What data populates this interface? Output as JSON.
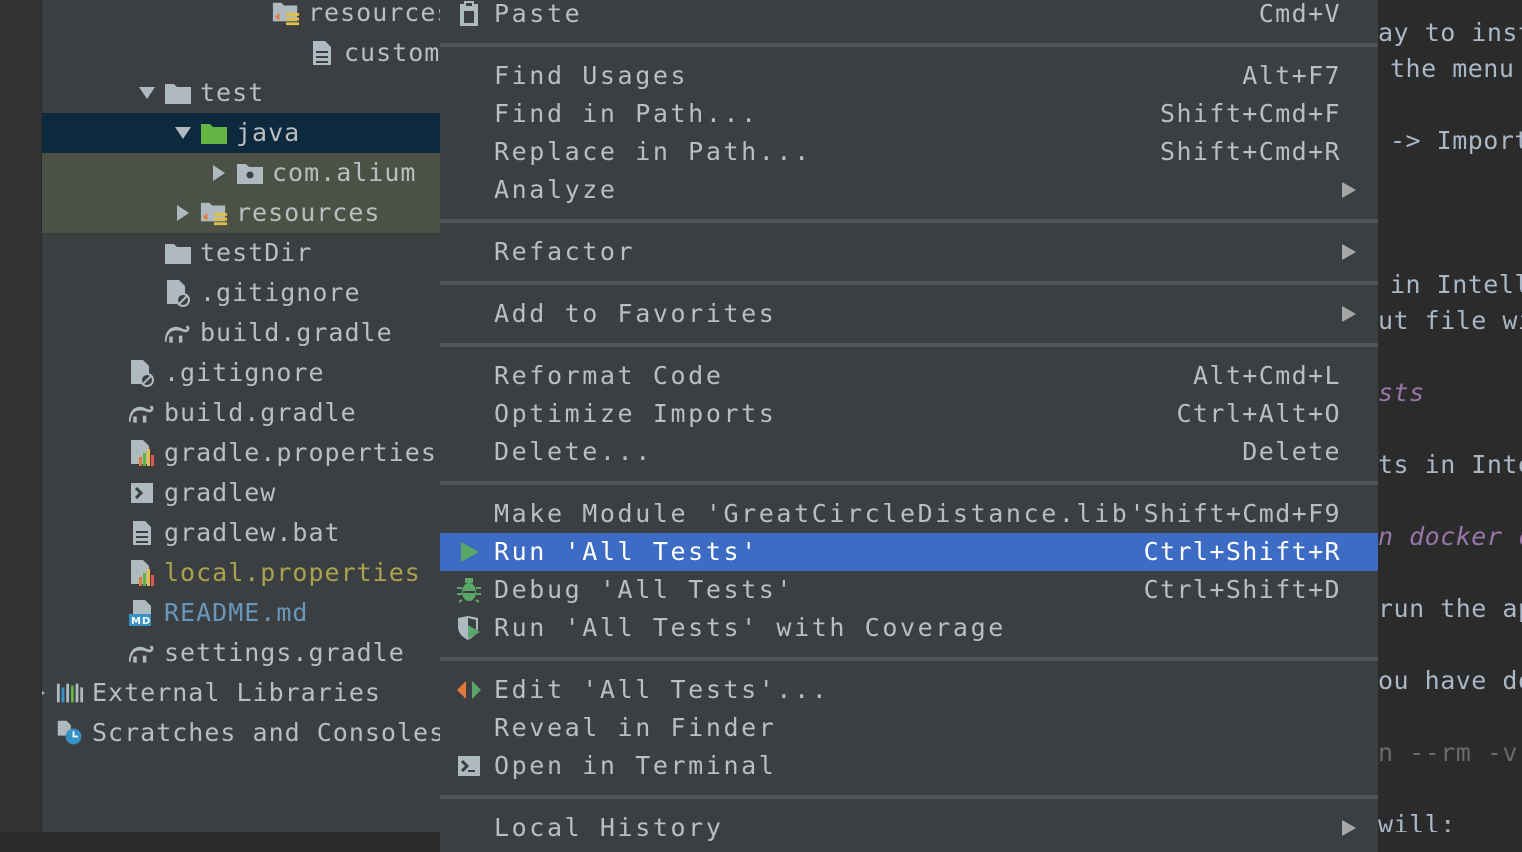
{
  "tree": {
    "rows": [
      {
        "label": "resources",
        "indent": 7,
        "arrow": "",
        "icon": "resources-folder-icon",
        "state": "normal",
        "color": "normal"
      },
      {
        "label": "customers",
        "indent": 8,
        "arrow": "",
        "icon": "file-icon",
        "state": "normal",
        "color": "normal"
      },
      {
        "label": "test",
        "indent": 4,
        "arrow": "down",
        "icon": "folder-icon",
        "state": "normal",
        "color": "normal"
      },
      {
        "label": "java",
        "indent": 5,
        "arrow": "down",
        "icon": "test-source-folder-icon",
        "state": "selected",
        "color": "normal"
      },
      {
        "label": "com.alium",
        "indent": 6,
        "arrow": "right",
        "icon": "package-icon",
        "state": "pkg",
        "color": "normal"
      },
      {
        "label": "resources",
        "indent": 5,
        "arrow": "right",
        "icon": "resources-folder-icon",
        "state": "pkg",
        "color": "normal"
      },
      {
        "label": "testDir",
        "indent": 4,
        "arrow": "",
        "icon": "folder-icon",
        "state": "normal",
        "color": "normal"
      },
      {
        "label": ".gitignore",
        "indent": 4,
        "arrow": "",
        "icon": "gitignore-icon",
        "state": "normal",
        "color": "normal"
      },
      {
        "label": "build.gradle",
        "indent": 4,
        "arrow": "",
        "icon": "gradle-icon",
        "state": "normal",
        "color": "normal"
      },
      {
        "label": ".gitignore",
        "indent": 3,
        "arrow": "",
        "icon": "gitignore-icon",
        "state": "normal",
        "color": "normal"
      },
      {
        "label": "build.gradle",
        "indent": 3,
        "arrow": "",
        "icon": "gradle-icon",
        "state": "normal",
        "color": "normal"
      },
      {
        "label": "gradle.properties",
        "indent": 3,
        "arrow": "",
        "icon": "properties-icon",
        "state": "normal",
        "color": "normal"
      },
      {
        "label": "gradlew",
        "indent": 3,
        "arrow": "",
        "icon": "shell-script-icon",
        "state": "normal",
        "color": "normal"
      },
      {
        "label": "gradlew.bat",
        "indent": 3,
        "arrow": "",
        "icon": "text-file-icon",
        "state": "normal",
        "color": "normal"
      },
      {
        "label": "local.properties",
        "indent": 3,
        "arrow": "",
        "icon": "properties-icon",
        "state": "normal",
        "color": "yellow"
      },
      {
        "label": "README.md",
        "indent": 3,
        "arrow": "",
        "icon": "markdown-icon",
        "state": "normal",
        "color": "blue"
      },
      {
        "label": "settings.gradle",
        "indent": 3,
        "arrow": "",
        "icon": "gradle-icon",
        "state": "normal",
        "color": "normal"
      },
      {
        "label": "External Libraries",
        "indent": 1,
        "arrow": "right",
        "icon": "library-icon",
        "state": "normal",
        "color": "normal"
      },
      {
        "label": "Scratches and Consoles",
        "indent": 1,
        "arrow": "",
        "icon": "scratches-icon",
        "state": "normal",
        "color": "normal"
      }
    ]
  },
  "menu": {
    "groups": [
      [
        {
          "label": "Paste",
          "shortcut": "Cmd+V",
          "submenu": false,
          "icon": "paste-icon",
          "active": false
        }
      ],
      [
        {
          "label": "Find Usages",
          "shortcut": "Alt+F7",
          "submenu": false,
          "icon": "",
          "active": false
        },
        {
          "label": "Find in Path...",
          "shortcut": "Shift+Cmd+F",
          "submenu": false,
          "icon": "",
          "active": false
        },
        {
          "label": "Replace in Path...",
          "shortcut": "Shift+Cmd+R",
          "submenu": false,
          "icon": "",
          "active": false
        },
        {
          "label": "Analyze",
          "shortcut": "",
          "submenu": true,
          "icon": "",
          "active": false
        }
      ],
      [
        {
          "label": "Refactor",
          "shortcut": "",
          "submenu": true,
          "icon": "",
          "active": false
        }
      ],
      [
        {
          "label": "Add to Favorites",
          "shortcut": "",
          "submenu": true,
          "icon": "",
          "active": false
        }
      ],
      [
        {
          "label": "Reformat Code",
          "shortcut": "Alt+Cmd+L",
          "submenu": false,
          "icon": "",
          "active": false
        },
        {
          "label": "Optimize Imports",
          "shortcut": "Ctrl+Alt+O",
          "submenu": false,
          "icon": "",
          "active": false
        },
        {
          "label": "Delete...",
          "shortcut": "Delete",
          "submenu": false,
          "icon": "",
          "active": false
        }
      ],
      [
        {
          "label": "Make Module 'GreatCircleDistance.lib'",
          "shortcut": "Shift+Cmd+F9",
          "submenu": false,
          "icon": "",
          "active": false
        },
        {
          "label": "Run 'All Tests'",
          "shortcut": "Ctrl+Shift+R",
          "submenu": false,
          "icon": "run-icon",
          "active": true
        },
        {
          "label": "Debug 'All Tests'",
          "shortcut": "Ctrl+Shift+D",
          "submenu": false,
          "icon": "debug-bug-icon",
          "active": false
        },
        {
          "label": "Run 'All Tests' with Coverage",
          "shortcut": "",
          "submenu": false,
          "icon": "coverage-shield-icon",
          "active": false
        }
      ],
      [
        {
          "label": "Edit 'All Tests'...",
          "shortcut": "",
          "submenu": false,
          "icon": "edit-config-icon",
          "active": false
        },
        {
          "label": "Reveal in Finder",
          "shortcut": "",
          "submenu": false,
          "icon": "",
          "active": false
        },
        {
          "label": "Open in Terminal",
          "shortcut": "",
          "submenu": false,
          "icon": "terminal-icon",
          "active": false
        }
      ],
      [
        {
          "label": "Local History",
          "shortcut": "",
          "submenu": true,
          "icon": "",
          "active": false
        }
      ]
    ]
  },
  "editor": {
    "lines": [
      {
        "text": "ay to insta",
        "style": "normal",
        "indent": 0
      },
      {
        "text": "the menu a",
        "style": "normal",
        "indent": 1
      },
      {
        "text": "",
        "style": "normal",
        "indent": 0
      },
      {
        "text": "-> Import",
        "style": "normal",
        "indent": 1
      },
      {
        "text": "",
        "style": "normal",
        "indent": 0
      },
      {
        "text": "",
        "style": "normal",
        "indent": 0
      },
      {
        "text": "",
        "style": "normal",
        "indent": 0
      },
      {
        "text": "in Intelli",
        "style": "normal",
        "indent": 1
      },
      {
        "text": "ut file wil",
        "style": "normal",
        "indent": 0
      },
      {
        "text": "",
        "style": "normal",
        "indent": 0
      },
      {
        "text": "sts",
        "style": "ital",
        "indent": 0
      },
      {
        "text": "",
        "style": "normal",
        "indent": 0
      },
      {
        "text": "ts in Inte",
        "style": "normal",
        "indent": 0
      },
      {
        "text": "",
        "style": "normal",
        "indent": 0
      },
      {
        "text": "n docker co",
        "style": "ital",
        "indent": 0
      },
      {
        "text": "",
        "style": "normal",
        "indent": 0
      },
      {
        "text": "run the app",
        "style": "normal",
        "indent": 0
      },
      {
        "text": "",
        "style": "normal",
        "indent": 0
      },
      {
        "text": "ou have doc",
        "style": "normal",
        "indent": 0
      },
      {
        "text": "",
        "style": "normal",
        "indent": 0
      },
      {
        "text": "n --rm -v s",
        "style": "dim",
        "indent": 0
      },
      {
        "text": "",
        "style": "normal",
        "indent": 0
      },
      {
        "text": "will:",
        "style": "normal",
        "indent": 0
      }
    ]
  }
}
